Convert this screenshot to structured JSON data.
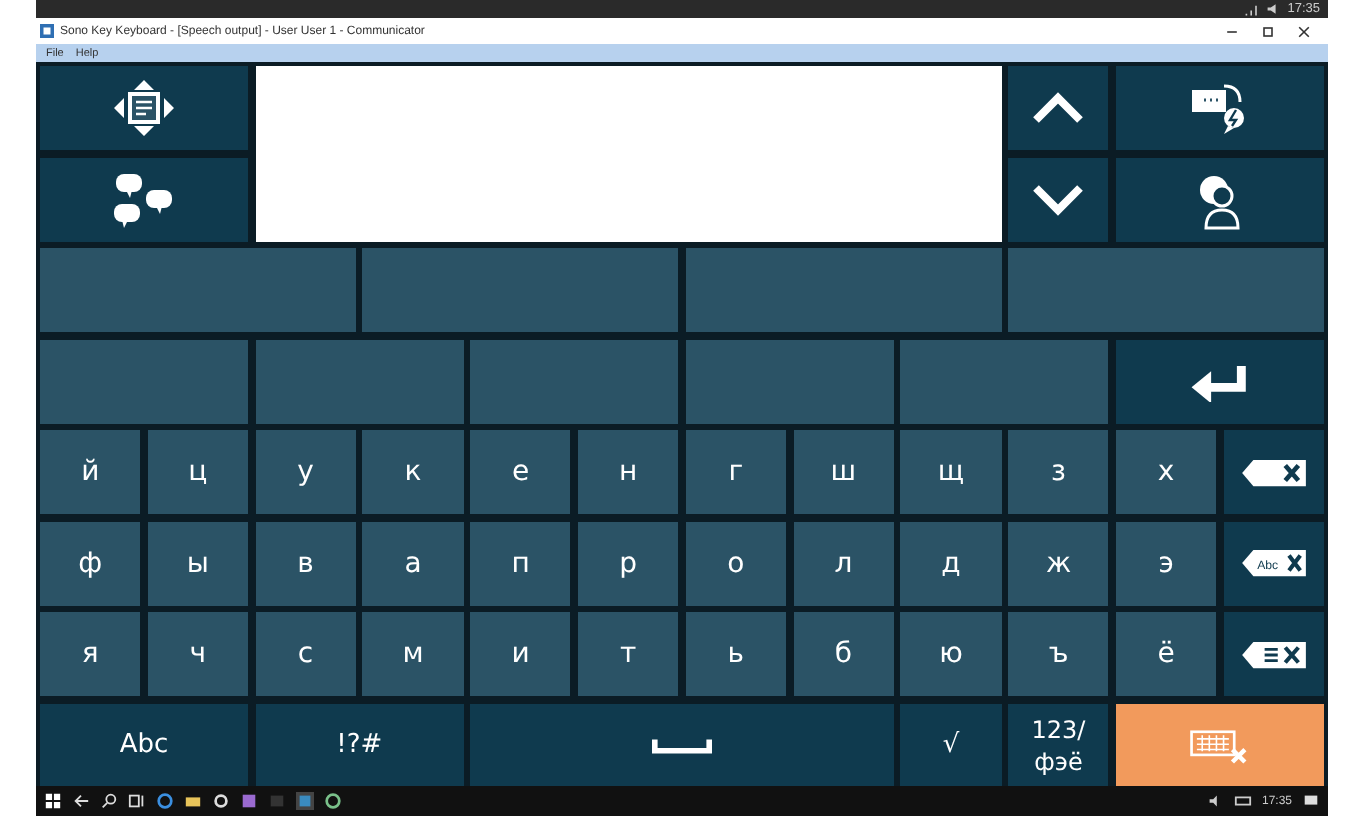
{
  "status_bar": {
    "time": "17:35"
  },
  "window": {
    "title": "Sono Key Keyboard - [Speech output] - User User 1 - Communicator"
  },
  "menu": [
    "File",
    "Help"
  ],
  "keyboard": {
    "top_left": [
      {
        "kind": "navigate"
      },
      {
        "kind": "phrases"
      }
    ],
    "top_right": [
      {
        "kind": "scroll-up"
      },
      {
        "kind": "speak"
      },
      {
        "kind": "scroll-down"
      },
      {
        "kind": "user"
      }
    ],
    "enter": {
      "kind": "enter"
    },
    "letter_rows": [
      {
        "letters": [
          "й",
          "ц",
          "у",
          "к",
          "е",
          "н",
          "г",
          "ш",
          "щ",
          "з",
          "х"
        ],
        "action": {
          "kind": "delete-char"
        }
      },
      {
        "letters": [
          "ф",
          "ы",
          "в",
          "а",
          "п",
          "р",
          "о",
          "л",
          "д",
          "ж",
          "э"
        ],
        "action": {
          "kind": "delete-word",
          "label": "Abc"
        }
      },
      {
        "letters": [
          "я",
          "ч",
          "с",
          "м",
          "и",
          "т",
          "ь",
          "б",
          "ю",
          "ъ",
          "ё"
        ],
        "action": {
          "kind": "delete-all"
        }
      }
    ],
    "bottom_row": [
      {
        "kind": "text",
        "label": "Abc"
      },
      {
        "kind": "text",
        "label": "!?#"
      },
      {
        "kind": "space"
      },
      {
        "kind": "text",
        "label": "√"
      },
      {
        "kind": "lines",
        "lines": [
          "123/",
          "фэё"
        ]
      },
      {
        "kind": "hide-keyboard"
      }
    ]
  },
  "taskbar": {
    "time": "17:35"
  }
}
